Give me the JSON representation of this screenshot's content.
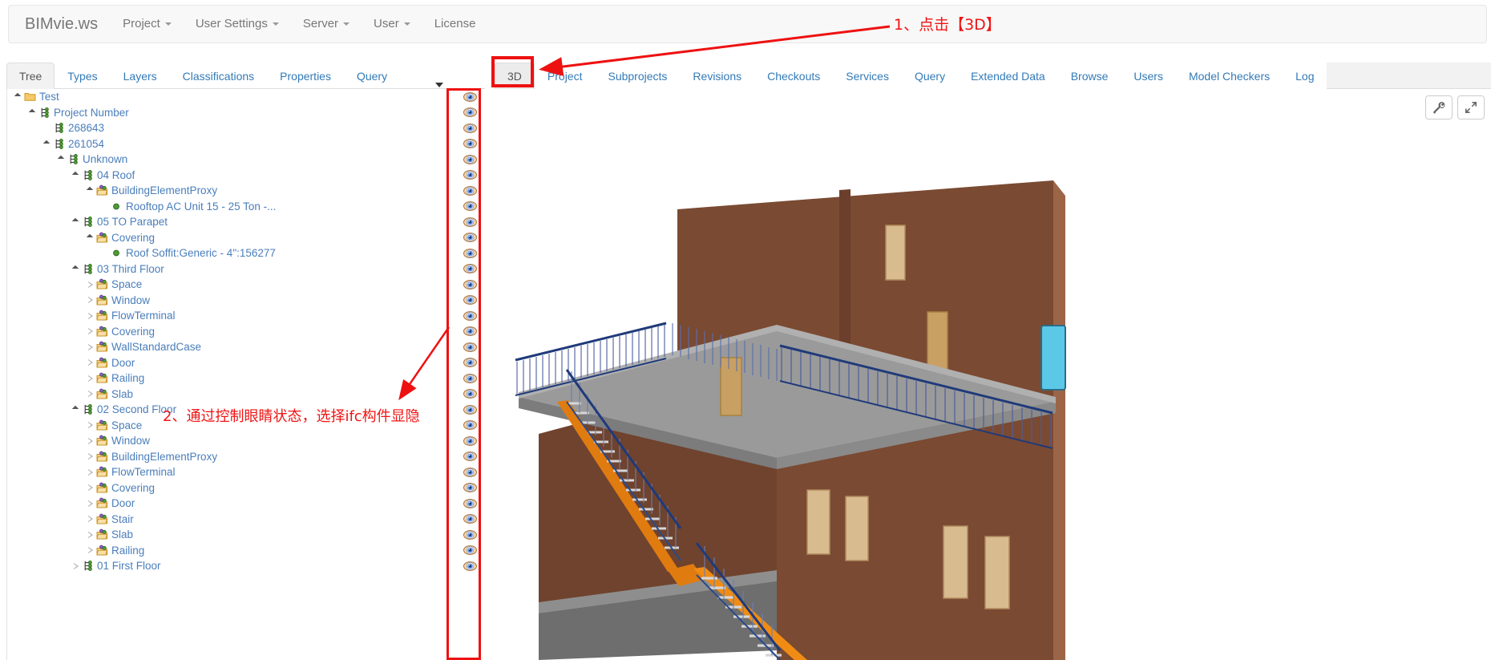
{
  "navbar": {
    "brand": "BIMvie.ws",
    "items": [
      {
        "label": "Project",
        "caret": true
      },
      {
        "label": "User Settings",
        "caret": true
      },
      {
        "label": "Server",
        "caret": true
      },
      {
        "label": "User",
        "caret": true
      },
      {
        "label": "License",
        "caret": false
      }
    ]
  },
  "left_panel": {
    "tabs": [
      {
        "label": "Tree",
        "active": true
      },
      {
        "label": "Types",
        "active": false
      },
      {
        "label": "Layers",
        "active": false
      },
      {
        "label": "Classifications",
        "active": false
      },
      {
        "label": "Properties",
        "active": false
      },
      {
        "label": "Query",
        "active": false
      }
    ],
    "tree": [
      {
        "label": "Test",
        "depth": 0,
        "twisty": "open",
        "icon": "folder-icon",
        "eye": true
      },
      {
        "label": "Project Number",
        "depth": 1,
        "twisty": "open",
        "icon": "ifc-node-icon",
        "eye": true
      },
      {
        "label": "268643",
        "depth": 2,
        "twisty": "none",
        "icon": "ifc-node-icon",
        "eye": true
      },
      {
        "label": "261054",
        "depth": 2,
        "twisty": "open",
        "icon": "ifc-node-icon",
        "eye": true
      },
      {
        "label": "Unknown",
        "depth": 3,
        "twisty": "open",
        "icon": "ifc-node-icon",
        "eye": true
      },
      {
        "label": "04 Roof",
        "depth": 4,
        "twisty": "open",
        "icon": "ifc-node-icon",
        "eye": true
      },
      {
        "label": "BuildingElementProxy",
        "depth": 5,
        "twisty": "open",
        "icon": "type-folder-icon",
        "eye": true
      },
      {
        "label": "Rooftop AC Unit 15 - 25 Ton -...",
        "depth": 6,
        "twisty": "none",
        "icon": "element-dot-icon",
        "eye": true
      },
      {
        "label": "05 TO Parapet",
        "depth": 4,
        "twisty": "open",
        "icon": "ifc-node-icon",
        "eye": true
      },
      {
        "label": "Covering",
        "depth": 5,
        "twisty": "open",
        "icon": "type-folder-icon",
        "eye": true
      },
      {
        "label": "Roof Soffit:Generic - 4\":156277",
        "depth": 6,
        "twisty": "none",
        "icon": "element-dot-icon",
        "eye": true
      },
      {
        "label": "03 Third Floor",
        "depth": 4,
        "twisty": "open",
        "icon": "ifc-node-icon",
        "eye": true
      },
      {
        "label": "Space",
        "depth": 5,
        "twisty": "closed",
        "icon": "type-folder-icon",
        "eye": true
      },
      {
        "label": "Window",
        "depth": 5,
        "twisty": "closed",
        "icon": "type-folder-icon",
        "eye": true
      },
      {
        "label": "FlowTerminal",
        "depth": 5,
        "twisty": "closed",
        "icon": "type-folder-icon",
        "eye": true
      },
      {
        "label": "Covering",
        "depth": 5,
        "twisty": "closed",
        "icon": "type-folder-icon",
        "eye": true
      },
      {
        "label": "WallStandardCase",
        "depth": 5,
        "twisty": "closed",
        "icon": "type-folder-icon",
        "eye": true
      },
      {
        "label": "Door",
        "depth": 5,
        "twisty": "closed",
        "icon": "type-folder-icon",
        "eye": true
      },
      {
        "label": "Railing",
        "depth": 5,
        "twisty": "closed",
        "icon": "type-folder-icon",
        "eye": true
      },
      {
        "label": "Slab",
        "depth": 5,
        "twisty": "closed",
        "icon": "type-folder-icon",
        "eye": true
      },
      {
        "label": "02 Second Floor",
        "depth": 4,
        "twisty": "open",
        "icon": "ifc-node-icon",
        "eye": true
      },
      {
        "label": "Space",
        "depth": 5,
        "twisty": "closed",
        "icon": "type-folder-icon",
        "eye": true
      },
      {
        "label": "Window",
        "depth": 5,
        "twisty": "closed",
        "icon": "type-folder-icon",
        "eye": true
      },
      {
        "label": "BuildingElementProxy",
        "depth": 5,
        "twisty": "closed",
        "icon": "type-folder-icon",
        "eye": true
      },
      {
        "label": "FlowTerminal",
        "depth": 5,
        "twisty": "closed",
        "icon": "type-folder-icon",
        "eye": true
      },
      {
        "label": "Covering",
        "depth": 5,
        "twisty": "closed",
        "icon": "type-folder-icon",
        "eye": true
      },
      {
        "label": "Door",
        "depth": 5,
        "twisty": "closed",
        "icon": "type-folder-icon",
        "eye": true
      },
      {
        "label": "Stair",
        "depth": 5,
        "twisty": "closed",
        "icon": "type-folder-icon",
        "eye": true
      },
      {
        "label": "Slab",
        "depth": 5,
        "twisty": "closed",
        "icon": "type-folder-icon",
        "eye": true
      },
      {
        "label": "Railing",
        "depth": 5,
        "twisty": "closed",
        "icon": "type-folder-icon",
        "eye": true
      },
      {
        "label": "01 First Floor",
        "depth": 4,
        "twisty": "closed",
        "icon": "ifc-node-icon",
        "eye": true
      }
    ]
  },
  "right_panel": {
    "tabs": [
      {
        "label": "3D",
        "active": true
      },
      {
        "label": "Project",
        "active": false
      },
      {
        "label": "Subprojects",
        "active": false
      },
      {
        "label": "Revisions",
        "active": false
      },
      {
        "label": "Checkouts",
        "active": false
      },
      {
        "label": "Services",
        "active": false
      },
      {
        "label": "Query",
        "active": false
      },
      {
        "label": "Extended Data",
        "active": false
      },
      {
        "label": "Browse",
        "active": false
      },
      {
        "label": "Users",
        "active": false
      },
      {
        "label": "Model Checkers",
        "active": false
      },
      {
        "label": "Log",
        "active": false
      }
    ],
    "viewer_tools": [
      {
        "name": "wrench-icon",
        "title": "Settings"
      },
      {
        "name": "expand-icon",
        "title": "Fullscreen"
      }
    ]
  },
  "annotations": [
    {
      "id": "anno1",
      "text": "1、点击【3D】"
    },
    {
      "id": "anno2",
      "text": "2、通过控制眼睛状态，选择ifc构件显隐"
    }
  ],
  "colors": {
    "annotation_red": "#f01414",
    "highlight_box_red": "#ee1111",
    "link_blue": "#337ab7",
    "tree_label_blue": "#4a7ebb",
    "wall_brown": "#7a4a32",
    "wall_brown_light": "#9c6548",
    "slab_gray": "#9a9a9a",
    "railing_blue": "#1f3a7a",
    "stair_orange": "#e07b10",
    "window_tan": "#c9a063",
    "window_cyan": "#5bc8e8"
  }
}
